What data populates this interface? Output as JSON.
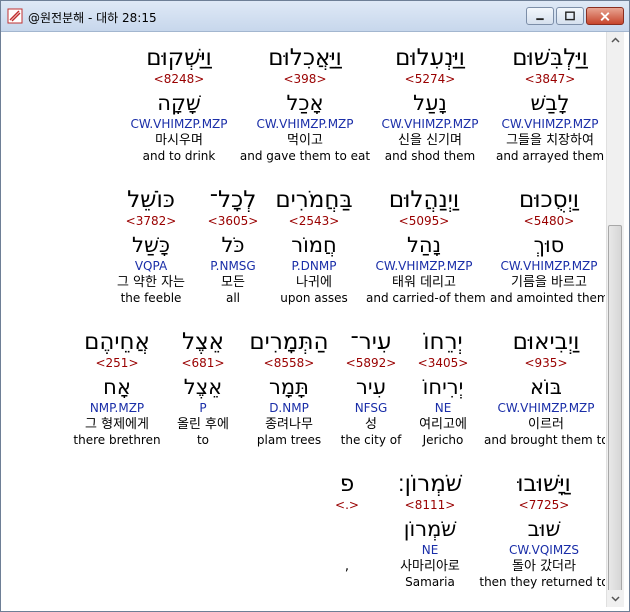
{
  "window": {
    "title": "@원전분해 - 대하 28:15",
    "colors": {
      "number": "#990000",
      "morph": "#1a2ea8",
      "text": "#000000"
    }
  },
  "rows": [
    {
      "words": [
        {
          "heb": "וַיַּלְבִּשׁוּם",
          "num": "<3847>",
          "lemma": "לָבַשׁ",
          "morph": "CW.VHIMZP.MZP",
          "kor": "그들을 치장하여",
          "eng": "and arrayed them"
        },
        {
          "heb": "וַיַּנְעִלוּם",
          "num": "<5274>",
          "lemma": "נָעַל",
          "morph": "CW.VHIMZP.MZP",
          "kor": "신을 신기며",
          "eng": "and shod them"
        },
        {
          "heb": "וַיַּאֲכִלוּם",
          "num": "<398>",
          "lemma": "אָכַל",
          "morph": "CW.VHIMZP.MZP",
          "kor": "먹이고",
          "eng": "and gave them to eat"
        },
        {
          "heb": "וַיַּשְׁקוּם",
          "num": "<8248>",
          "lemma": "שָׁקָה",
          "morph": "CW.VHIMZP.MZP",
          "kor": "마시우며",
          "eng": "and to drink"
        }
      ]
    },
    {
      "words": [
        {
          "heb": "וַיְסֻכוּם",
          "num": "<5480>",
          "lemma": "סוּךְ",
          "morph": "CW.VHIMZP.MZP",
          "kor": "기름을 바르고",
          "eng": "and amointed them"
        },
        {
          "heb": "וַיְנַהֲלוּם",
          "num": "<5095>",
          "lemma": "נָהַל",
          "morph": "CW.VHIMZP.MZP",
          "kor": "태워 데리고",
          "eng": "and carried-of them"
        },
        {
          "heb": "בַּחֲמֹרִים",
          "num": "<2543>",
          "lemma": "חֲמוֹר",
          "morph": "P.DNMP",
          "kor": "나귀에",
          "eng": "upon asses"
        },
        {
          "heb": "לְכָל־",
          "num": "<3605>",
          "lemma": "כֹּל",
          "morph": "P.NMSG",
          "kor": "모든",
          "eng": "all"
        },
        {
          "heb": "כּוֹשֵׁל",
          "num": "<3782>",
          "lemma": "כָּשַׁל",
          "morph": "VQPA",
          "kor": "그 약한 자는",
          "eng": "the feeble"
        }
      ]
    },
    {
      "words": [
        {
          "heb": "וַיְבִיאוּם",
          "num": "<935>",
          "lemma": "בּוֹא",
          "morph": "CW.VHIMZP.MZP",
          "kor": "이르러",
          "eng": "and brought them to"
        },
        {
          "heb": "יְרֵחוֹ",
          "num": "<3405>",
          "lemma": "יְרִיחוֹ",
          "morph": "NE",
          "kor": "여리고에",
          "eng": "Jericho"
        },
        {
          "heb": "עִיר־",
          "num": "<5892>",
          "lemma": "עִיר",
          "morph": "NFSG",
          "kor": "성",
          "eng": "the city of"
        },
        {
          "heb": "הַתְּמָרִים",
          "num": "<8558>",
          "lemma": "תָּמָר",
          "morph": "D.NMP",
          "kor": "종려나무",
          "eng": "plam trees"
        },
        {
          "heb": "אֵצֶל",
          "num": "<681>",
          "lemma": "אֵצֶל",
          "morph": "P",
          "kor": "올린 후에",
          "eng": "to"
        },
        {
          "heb": "אֲחֵיהֶם",
          "num": "<251>",
          "lemma": "אָח",
          "morph": "NMP.MZP",
          "kor": "그 형제에게",
          "eng": "there brethren"
        }
      ]
    },
    {
      "words": [
        {
          "heb": "וַיָּשׁוּבוּ",
          "num": "<7725>",
          "lemma": "שׁוּב",
          "morph": "CW.VQIMZS",
          "kor": "돌아 갔더라",
          "eng": "then they returned to"
        },
        {
          "heb": "שֹׁמְרוֹן׃",
          "num": "<8111>",
          "lemma": "שֹׁמְרוֹן",
          "morph": "NE",
          "kor": "사마리아로",
          "eng": "Samaria"
        },
        {
          "heb": "פ",
          "num": "<.>",
          "lemma": "",
          "morph": "",
          "kor": ",",
          "eng": ""
        }
      ]
    }
  ]
}
